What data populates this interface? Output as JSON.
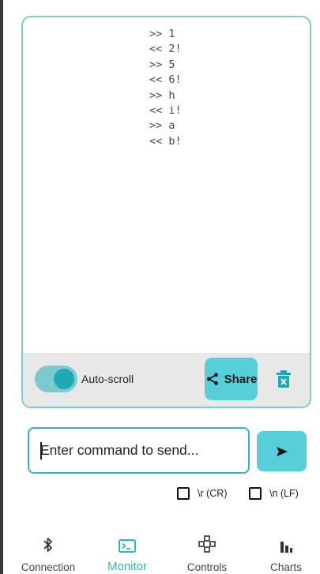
{
  "colors": {
    "accent": "#56cfd8",
    "accent_dark": "#1fa9b5",
    "border": "#7fc9d1",
    "toolbar_bg": "#e8e8e8"
  },
  "monitor": {
    "log": [
      ">> 1",
      "<< 2!",
      ">> 5",
      "<< 6!",
      ">> h",
      "<< i!",
      ">> a",
      "<< b!"
    ],
    "autoscroll": {
      "label": "Auto-scroll",
      "enabled": true
    },
    "share_label": "Share",
    "clear_icon": "trash-icon"
  },
  "command": {
    "placeholder": "Enter command to send...",
    "value": "",
    "send_icon": "send-arrow-icon"
  },
  "options": [
    {
      "label": "\\r (CR)",
      "checked": false
    },
    {
      "label": "\\n (LF)",
      "checked": false
    }
  ],
  "nav": [
    {
      "label": "Connection",
      "icon": "bluetooth-icon",
      "active": false
    },
    {
      "label": "Monitor",
      "icon": "terminal-icon",
      "active": true
    },
    {
      "label": "Controls",
      "icon": "gamepad-icon",
      "active": false
    },
    {
      "label": "Charts",
      "icon": "bar-chart-icon",
      "active": false
    }
  ]
}
